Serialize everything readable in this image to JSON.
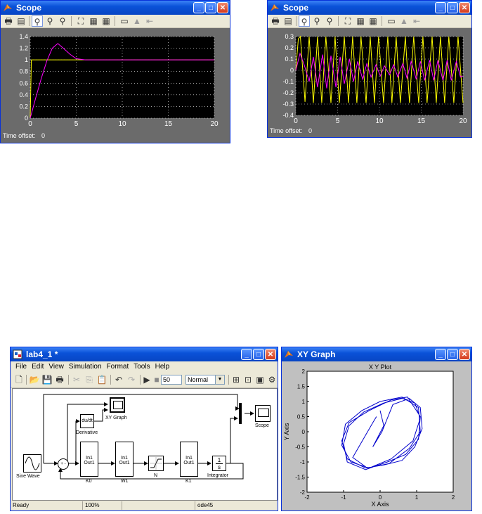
{
  "scope1": {
    "title": "Scope",
    "time_offset_label": "Time offset:",
    "time_offset_value": "0",
    "chart_data": {
      "type": "line",
      "xlim": [
        0,
        20
      ],
      "ylim": [
        0,
        1.4
      ],
      "xticks": [
        0,
        5,
        10,
        15,
        20
      ],
      "yticks": [
        0,
        0.2,
        0.4,
        0.6,
        0.8,
        1,
        1.2,
        1.4
      ],
      "ytick_labels": [
        "0",
        "0.2",
        "0.4",
        "0.6",
        "0.8",
        "1",
        "1.2",
        "1.4"
      ],
      "grid": true,
      "series": [
        {
          "color": "#ffff00",
          "x": [
            0,
            0.12,
            20
          ],
          "y": [
            0,
            1,
            1
          ]
        },
        {
          "color": "#ff00ff",
          "x": [
            0,
            0.6,
            1.2,
            1.8,
            2.4,
            3.0,
            3.6,
            4.3,
            5.0,
            6.0,
            7.0,
            20
          ],
          "y": [
            0,
            0.35,
            0.68,
            0.98,
            1.2,
            1.28,
            1.2,
            1.1,
            1.02,
            1.0,
            1.0,
            1.0
          ]
        }
      ]
    }
  },
  "scope2": {
    "title": "Scope",
    "time_offset_label": "Time offset:",
    "time_offset_value": "0",
    "chart_data": {
      "type": "line",
      "xlim": [
        0,
        20
      ],
      "ylim": [
        -0.4,
        0.3
      ],
      "xticks": [
        0,
        5,
        10,
        15,
        20
      ],
      "yticks": [
        -0.4,
        -0.3,
        -0.2,
        -0.1,
        0,
        0.1,
        0.2,
        0.3
      ],
      "ytick_labels": [
        "-0.4",
        "-0.3",
        "-0.2",
        "-0.1",
        "0",
        "0.1",
        "0.2",
        "0.3"
      ],
      "grid": true,
      "series": [
        {
          "color": "#ffff00",
          "x": [
            0,
            0.3,
            0.55,
            1.1,
            1.6,
            2.1,
            2.6,
            3.1,
            3.6,
            4.2,
            4.7,
            5.2,
            5.8,
            6.3,
            6.8,
            7.3,
            7.8,
            8.4,
            8.9,
            9.4,
            9.9,
            10.5,
            11.0,
            11.5,
            12.0,
            12.5,
            13.1,
            13.6,
            14.1,
            14.7,
            15.2,
            15.7,
            16.3,
            16.8,
            17.3,
            17.8,
            18.3,
            18.9,
            19.4,
            20
          ],
          "y": [
            0,
            0.28,
            0.3,
            -0.28,
            0.3,
            -0.29,
            0.3,
            -0.29,
            0.3,
            -0.29,
            0.3,
            -0.29,
            0.3,
            -0.29,
            0.3,
            -0.29,
            0.3,
            -0.29,
            0.3,
            -0.29,
            0.3,
            -0.29,
            0.3,
            -0.29,
            0.3,
            -0.29,
            0.3,
            -0.29,
            0.3,
            -0.29,
            0.3,
            -0.29,
            0.3,
            -0.29,
            0.3,
            -0.29,
            0.3,
            -0.29,
            0.3,
            -0.29
          ]
        },
        {
          "color": "#ff00ff",
          "x": [
            0,
            0.5,
            1.0,
            1.6,
            2.1,
            2.6,
            3.2,
            3.7,
            4.2,
            4.8,
            5.3,
            5.8,
            6.4,
            6.9,
            7.4,
            8.0,
            8.5,
            9.0,
            9.6,
            10.1,
            10.6,
            11.2,
            11.7,
            12.2,
            12.8,
            13.3,
            13.8,
            14.4,
            14.9,
            15.4,
            16.0,
            16.5,
            17.0,
            17.6,
            18.1,
            18.6,
            19.2,
            19.7,
            20
          ],
          "y": [
            0,
            0.15,
            0.05,
            -0.1,
            0.12,
            -0.15,
            0.14,
            -0.16,
            0.13,
            -0.15,
            0.12,
            -0.12,
            0.1,
            -0.1,
            0.08,
            -0.08,
            0.06,
            -0.06,
            0.05,
            -0.05,
            0.04,
            -0.04,
            0.05,
            -0.06,
            0.06,
            -0.07,
            0.08,
            -0.08,
            0.08,
            -0.09,
            0.09,
            -0.09,
            0.09,
            -0.09,
            0.09,
            -0.09,
            0.08,
            -0.06,
            -0.05
          ]
        }
      ]
    }
  },
  "model": {
    "title": "lab4_1 *",
    "menu": [
      "File",
      "Edit",
      "View",
      "Simulation",
      "Format",
      "Tools",
      "Help"
    ],
    "stop_time": "50",
    "sim_mode": "Normal",
    "blocks": {
      "sine": "Sine Wave",
      "derivative": "Derivative",
      "derivative_text": "du/dt",
      "xygraph": "XY Graph",
      "k0": "K0",
      "w1": "W1",
      "n": "N",
      "k1": "K1",
      "integrator": "Integrator",
      "scope": "Scope",
      "inout": "In1 Out1",
      "int_num": "1",
      "int_den": "s",
      "sum_signs": "+ -"
    },
    "status": {
      "ready": "Ready",
      "zoom": "100%",
      "solver": "ode45"
    }
  },
  "xy": {
    "title": "XY Graph",
    "chart_data": {
      "type": "line",
      "title": "X Y Plot",
      "xlabel": "X Axis",
      "ylabel": "Y Axis",
      "xlim": [
        -2,
        2
      ],
      "ylim": [
        -2,
        2
      ],
      "xticks": [
        -2,
        -1,
        0,
        1,
        2
      ],
      "yticks": [
        -2,
        -1.5,
        -1,
        -0.5,
        0,
        0.5,
        1,
        1.5,
        2
      ],
      "ytick_labels": [
        "-2",
        "-1.5",
        "-1",
        "-0.5",
        "0",
        "0.5",
        "1",
        "1.5",
        "2"
      ],
      "series": [
        {
          "color": "#0000cc",
          "x": [
            0.0,
            0.1,
            -0.2,
            0.05,
            0.35,
            0.8,
            1.1,
            1.15,
            0.95,
            0.6,
            0.1,
            -0.4,
            -0.9,
            -1.05,
            -0.85,
            -0.3,
            0.3,
            0.75,
            1.1,
            1.05,
            0.7,
            0.2,
            -0.4,
            -0.9,
            -1.0,
            -0.85,
            -0.45,
            0.1,
            0.6,
            0.95,
            1.1,
            0.9,
            0.3,
            -0.3,
            -0.8,
            -1.05,
            -0.95,
            -0.5,
            0.0,
            0.6,
            1.05,
            1.1,
            0.8,
            0.25,
            -0.35,
            -0.75,
            -0.2,
            -0.1
          ],
          "y": [
            0.7,
            0.2,
            -0.5,
            0.0,
            0.9,
            1.1,
            0.8,
            0.1,
            -0.5,
            -0.95,
            -1.1,
            -1.2,
            -0.9,
            -0.3,
            0.3,
            0.7,
            1.05,
            1.15,
            0.5,
            -0.25,
            -0.75,
            -1.0,
            -1.25,
            -1.0,
            -0.4,
            0.2,
            0.65,
            0.95,
            1.1,
            0.95,
            0.45,
            -0.3,
            -0.9,
            -1.2,
            -1.0,
            -0.45,
            0.25,
            0.7,
            1.0,
            1.15,
            0.8,
            0.0,
            -0.55,
            -1.05,
            -1.2,
            -0.85,
            0.3,
            0.5
          ]
        }
      ]
    }
  }
}
